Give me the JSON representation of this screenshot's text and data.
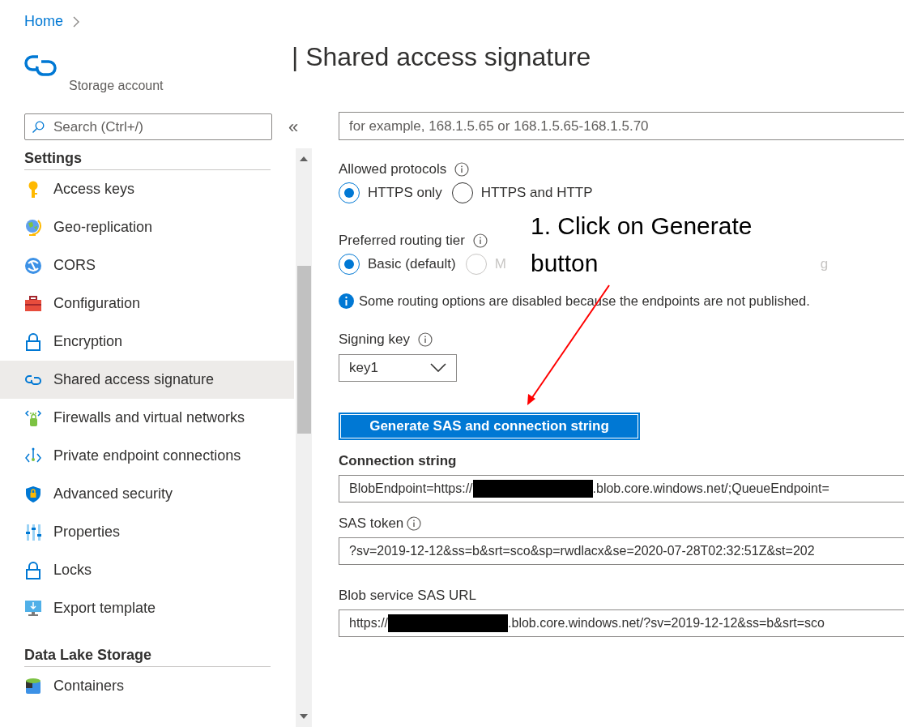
{
  "breadcrumb": {
    "items": [
      {
        "label": "Home"
      }
    ]
  },
  "resource": {
    "subtitle": "Storage account"
  },
  "page_title": "| Shared access signature",
  "sidebar": {
    "search": {
      "placeholder": "Search (Ctrl+/)"
    },
    "collapse": "«",
    "sections": [
      {
        "title": "Settings",
        "items": [
          {
            "label": "Access keys",
            "selected": false
          },
          {
            "label": "Geo-replication",
            "selected": false
          },
          {
            "label": "CORS",
            "selected": false
          },
          {
            "label": "Configuration",
            "selected": false
          },
          {
            "label": "Encryption",
            "selected": false
          },
          {
            "label": "Shared access signature",
            "selected": true
          },
          {
            "label": "Firewalls and virtual networks",
            "selected": false
          },
          {
            "label": "Private endpoint connections",
            "selected": false
          },
          {
            "label": "Advanced security",
            "selected": false
          },
          {
            "label": "Properties",
            "selected": false
          },
          {
            "label": "Locks",
            "selected": false
          },
          {
            "label": "Export template",
            "selected": false
          }
        ]
      },
      {
        "title": "Data Lake Storage",
        "items": [
          {
            "label": "Containers",
            "selected": false
          }
        ]
      }
    ]
  },
  "form": {
    "ip_field": {
      "placeholder": "for example, 168.1.5.65 or 168.1.5.65-168.1.5.70"
    },
    "protocols": {
      "label": "Allowed protocols",
      "options": [
        {
          "label": "HTTPS only",
          "selected": true,
          "disabled": false
        },
        {
          "label": "HTTPS and HTTP",
          "selected": false,
          "disabled": false
        }
      ]
    },
    "routing": {
      "label": "Preferred routing tier",
      "options": [
        {
          "label": "Basic (default)",
          "selected": true,
          "disabled": false
        },
        {
          "label": "M",
          "selected": false,
          "disabled": true
        }
      ],
      "covered_tail": "g"
    },
    "info": "Some routing options are disabled because the endpoints are not published.",
    "signing_key": {
      "label": "Signing key",
      "value": "key1"
    },
    "generate_button": "Generate SAS and connection string",
    "outputs": [
      {
        "label": "Connection string",
        "info": false,
        "prefix": "BlobEndpoint=https://",
        "redacted": true,
        "suffix": ".blob.core.windows.net/;QueueEndpoint="
      },
      {
        "label": "SAS token",
        "info": true,
        "prefix": "?sv=2019-12-12&ss=b&srt=sco&sp=rwdlacx&se=2020-07-28T02:32:51Z&st=202",
        "redacted": false
      },
      {
        "label": "Blob service SAS URL",
        "info": false,
        "prefix": "https://",
        "redacted": true,
        "suffix": ".blob.core.windows.net/?sv=2019-12-12&ss=b&srt=sco"
      }
    ]
  },
  "annotation": {
    "text": "1. Click on Generate button"
  }
}
